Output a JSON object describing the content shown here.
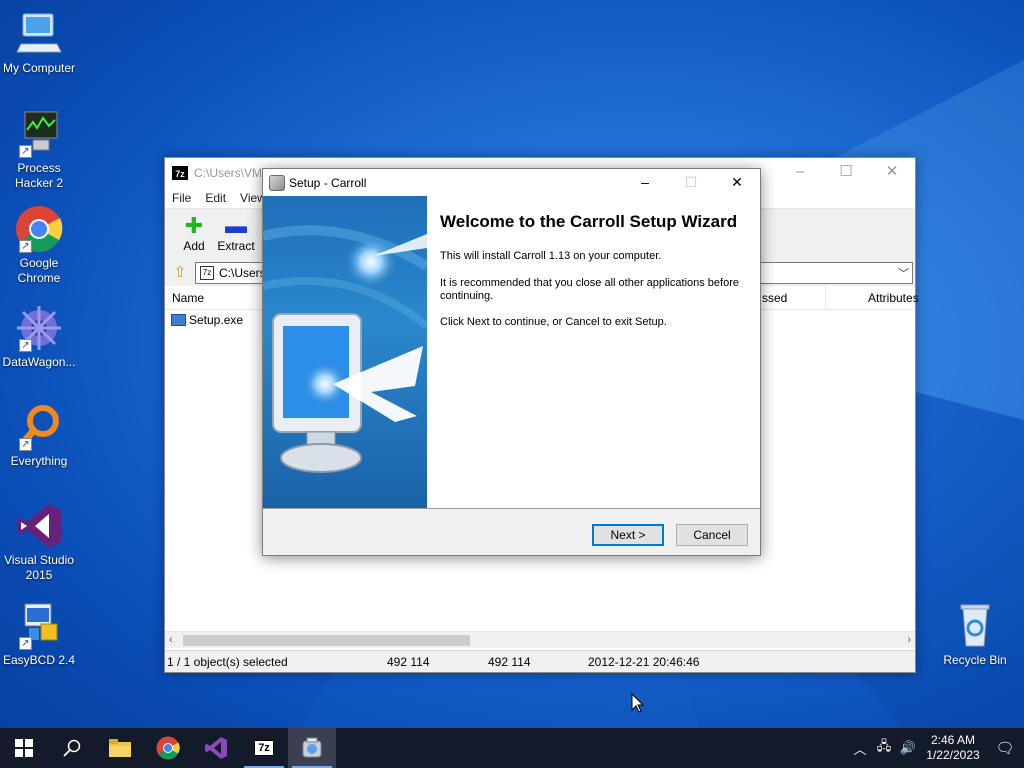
{
  "desktop": {
    "icons": [
      {
        "label": "My Computer",
        "icon": "computer-icon"
      },
      {
        "label": "Process Hacker 2",
        "icon": "process-hacker-icon"
      },
      {
        "label": "Google Chrome",
        "icon": "chrome-icon"
      },
      {
        "label": "DataWagon...",
        "icon": "datawagon-icon"
      },
      {
        "label": "Everything",
        "icon": "everything-icon"
      },
      {
        "label": "Visual Studio 2015",
        "icon": "visual-studio-icon"
      },
      {
        "label": "EasyBCD 2.4",
        "icon": "easybcd-icon"
      },
      {
        "label": "Recycle Bin",
        "icon": "recycle-bin-icon"
      }
    ]
  },
  "sevenzip": {
    "title": "C:\\Users\\VM\\Downloads\\Carroll\\",
    "app_icon": "7z",
    "menu": [
      "File",
      "Edit",
      "View"
    ],
    "toolbar": [
      {
        "label": "Add",
        "icon": "add-icon",
        "color": "#22b422"
      },
      {
        "label": "Extract",
        "icon": "extract-icon",
        "color": "#1d3fc7"
      }
    ],
    "address": "C:\\Users",
    "columns": {
      "name": "Name",
      "packed": "Packed Size",
      "packed_visible": "ssed",
      "attributes": "Attributes"
    },
    "files": [
      {
        "name": "Setup.exe"
      }
    ],
    "status": {
      "selection": "1 / 1 object(s) selected",
      "size": "492 114",
      "packed": "492 114",
      "modified": "2012-12-21 20:46:46"
    }
  },
  "setup": {
    "title": "Setup - Carroll",
    "heading": "Welcome to the Carroll Setup Wizard",
    "p1": "This will install Carroll 1.13 on your computer.",
    "p2": "It is recommended that you close all other applications before continuing.",
    "p3": "Click Next to continue, or Cancel to exit Setup.",
    "next": "Next >",
    "cancel": "Cancel"
  },
  "taskbar": {
    "apps": [
      "start-icon",
      "search-icon",
      "file-explorer-icon",
      "chrome-icon",
      "visual-studio-icon",
      "sevenzip-icon",
      "setup-icon"
    ],
    "time": "2:46 AM",
    "date": "1/22/2023"
  },
  "colors": {
    "desktop": "#1f6fd6",
    "taskbar": "#131a29",
    "accent": "#0078d7"
  }
}
